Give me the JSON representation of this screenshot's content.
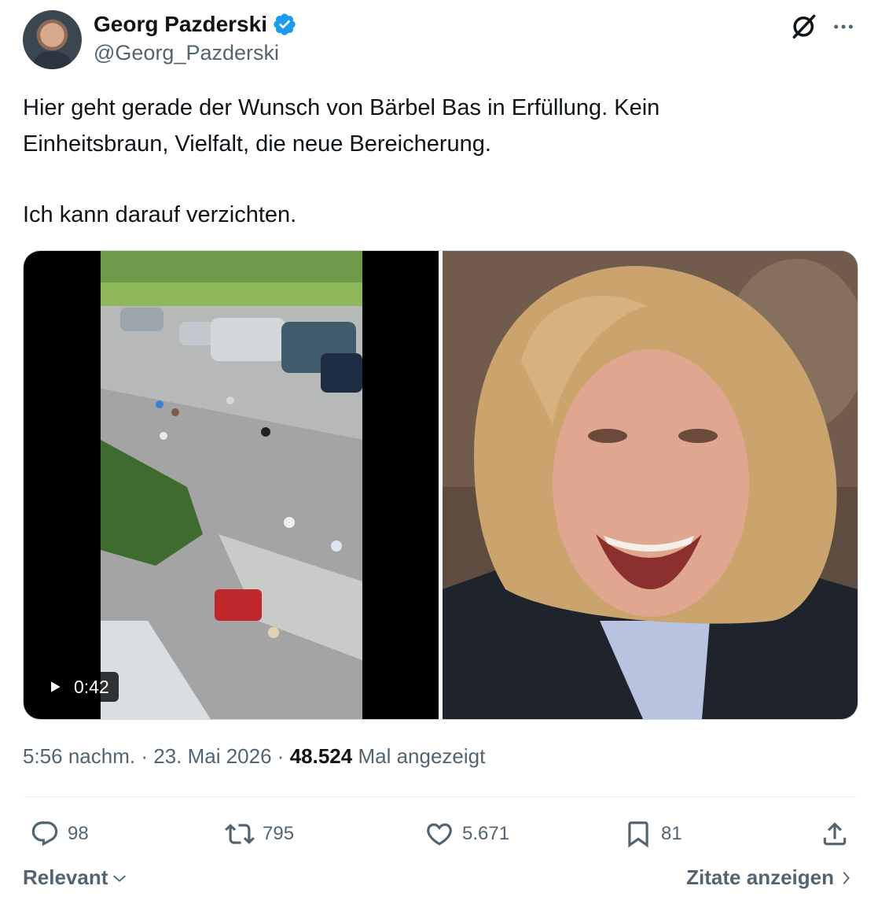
{
  "author": {
    "display_name": "Georg Pazderski",
    "handle": "@Georg_Pazderski",
    "verified": true
  },
  "tweet": {
    "text_lines": [
      "Hier geht gerade der Wunsch von Bärbel Bas in Erfüllung. Kein",
      "Einheitsbraun, Vielfalt, die neue Bereicherung.",
      "Ich kann darauf verzichten."
    ]
  },
  "media": {
    "video_duration": "0:42"
  },
  "meta": {
    "time": "5:56 nachm.",
    "separator": "·",
    "date": "23. Mai 2026",
    "views_count": "48.524",
    "views_label": "Mal angezeigt"
  },
  "actions": {
    "replies": "98",
    "retweets": "795",
    "likes": "5.671",
    "bookmarks": "81"
  },
  "footer": {
    "sort_label": "Relevant",
    "quotes_label": "Zitate anzeigen"
  },
  "colors": {
    "text_primary": "#0f1419",
    "text_secondary": "#536471",
    "verified_blue": "#1d9bf0",
    "divider": "#eff3f4"
  },
  "icons": [
    "verified-badge-icon",
    "grok-icon",
    "more-icon",
    "play-icon",
    "reply-icon",
    "retweet-icon",
    "like-icon",
    "bookmark-icon",
    "share-icon",
    "chevron-down-icon",
    "chevron-right-icon"
  ]
}
